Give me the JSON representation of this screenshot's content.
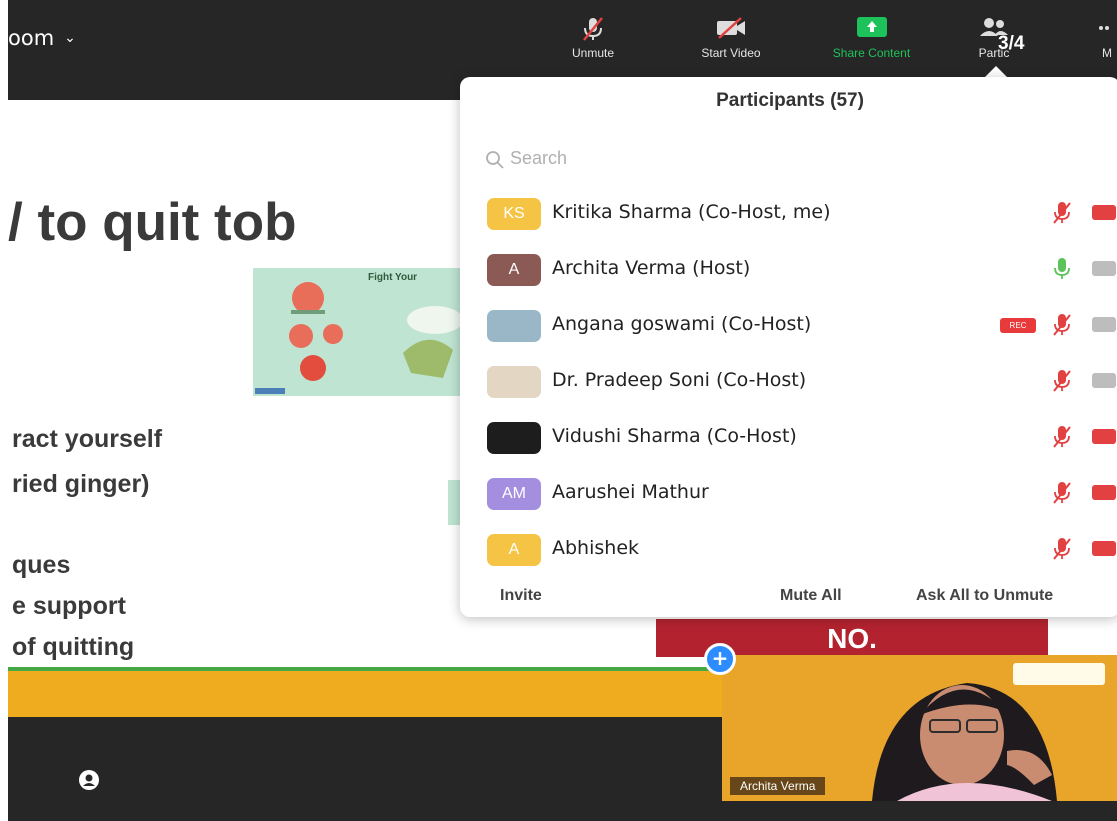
{
  "app": {
    "name": "oom",
    "menu_chevron": "⌄"
  },
  "toolbar": {
    "unmute_label": "Unmute",
    "start_video_label": "Start Video",
    "share_content_label": "Share Content",
    "participants_label": "Partic",
    "more_label": "M",
    "participant_count": "3/4",
    "icons": [
      "muted-mic-icon",
      "video-off-icon",
      "share-arrow-icon",
      "people-icon",
      "more-icon"
    ],
    "colors": {
      "background": "#262626",
      "share_green": "#1ec25a"
    }
  },
  "slide": {
    "title": "/ to quit tob",
    "lines": [
      "ract yourself",
      "ried ginger)",
      "ques",
      "e support",
      "of quitting"
    ],
    "image_caption": "Fight Your",
    "banner_text": "NO."
  },
  "participants_panel": {
    "title": "Participants (57)",
    "search_placeholder": "Search",
    "participants": [
      {
        "name": "Kritika Sharma (Co-Host, me)",
        "initials": "KS",
        "avatar_color": "#f6c445",
        "rec": false,
        "mic": "muted",
        "video": "off"
      },
      {
        "name": "Archita Verma (Host)",
        "initials": "A",
        "avatar_color": "#8b5a55",
        "rec": false,
        "mic": "on",
        "video": "on"
      },
      {
        "name": "Angana goswami (Co-Host)",
        "initials": "",
        "avatar_color": "#9ab7c8",
        "rec": true,
        "rec_label": "REC",
        "mic": "muted",
        "video": "on"
      },
      {
        "name": "Dr. Pradeep Soni (Co-Host)",
        "initials": "",
        "avatar_color": "#e3d6c3",
        "rec": false,
        "mic": "muted",
        "video": "on"
      },
      {
        "name": "Vidushi Sharma (Co-Host)",
        "initials": "",
        "avatar_color": "#1d1d1d",
        "rec": false,
        "mic": "muted",
        "video": "off"
      },
      {
        "name": "Aarushei Mathur",
        "initials": "AM",
        "avatar_color": "#a48ee0",
        "rec": false,
        "mic": "muted",
        "video": "off"
      },
      {
        "name": "Abhishek",
        "initials": "A",
        "avatar_color": "#f6c445",
        "rec": false,
        "mic": "muted",
        "video": "off"
      }
    ],
    "footer": {
      "invite": "Invite",
      "mute_all": "Mute All",
      "ask_all_unmute": "Ask All to Unmute"
    }
  },
  "video_thumbnail": {
    "name": "Archita Verma",
    "logo_text": ""
  },
  "pin_button_glyph": "+"
}
